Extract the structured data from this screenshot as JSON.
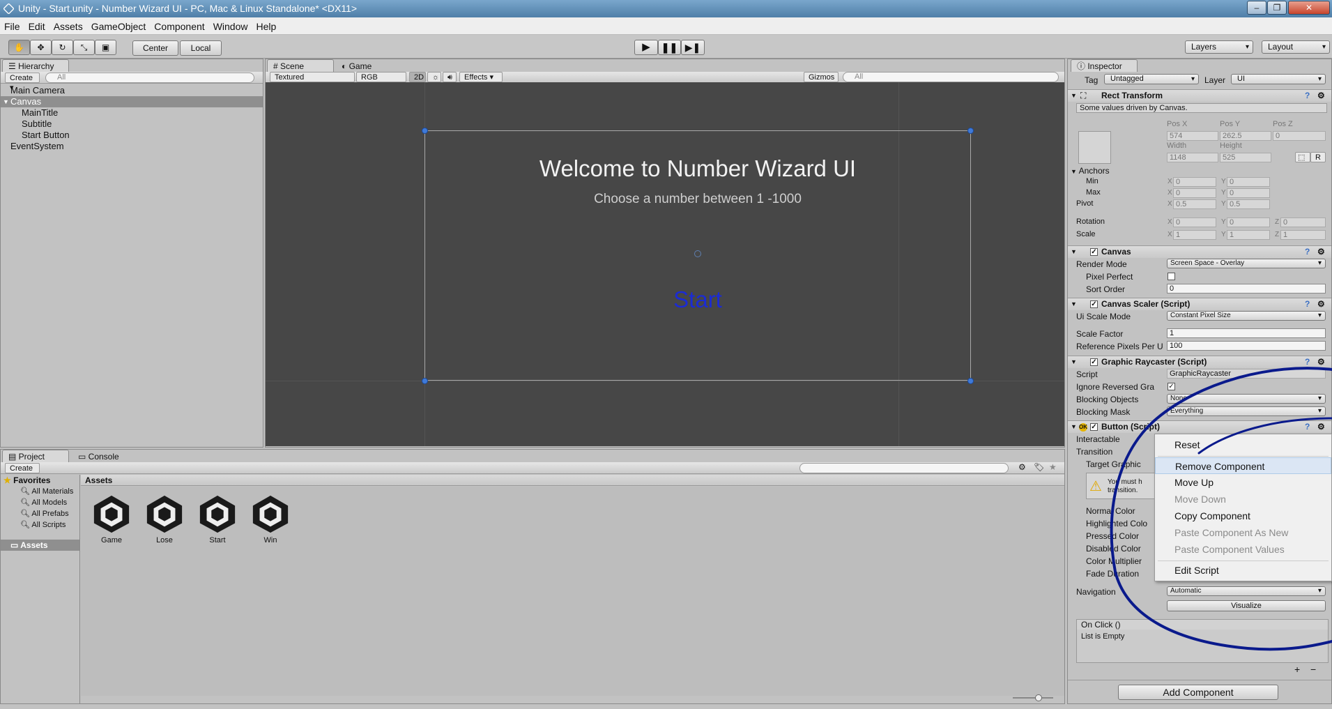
{
  "window": {
    "title": "Unity - Start.unity - Number Wizard UI - PC, Mac & Linux Standalone* <DX11>"
  },
  "menu": [
    "File",
    "Edit",
    "Assets",
    "GameObject",
    "Component",
    "Window",
    "Help"
  ],
  "toolbar": {
    "center": "Center",
    "local": "Local",
    "layers": "Layers",
    "layout": "Layout"
  },
  "hierarchy": {
    "tab": "Hierarchy",
    "create": "Create",
    "search": "All",
    "items": [
      "Main Camera",
      "Canvas",
      "MainTitle",
      "Subtitle",
      "Start Button",
      "EventSystem"
    ]
  },
  "scene": {
    "tab_scene": "Scene",
    "tab_game": "Game",
    "shading": "Textured",
    "rgb": "RGB",
    "mode2d": "2D",
    "effects": "Effects",
    "gizmos": "Gizmos",
    "search": "All",
    "title": "Welcome to Number Wizard UI",
    "subtitle": "Choose a number between 1 -1000",
    "start": "Start",
    "start_color": "#1b2bd4"
  },
  "project": {
    "tab_project": "Project",
    "tab_console": "Console",
    "create": "Create",
    "favorites": "Favorites",
    "fav_items": [
      "All Materials",
      "All Models",
      "All Prefabs",
      "All Scripts"
    ],
    "assets_folder": "Assets",
    "assets_header": "Assets",
    "assets": [
      "Game",
      "Lose",
      "Start",
      "Win"
    ]
  },
  "inspector": {
    "tab": "Inspector",
    "tag_label": "Tag",
    "tag": "Untagged",
    "layer_label": "Layer",
    "layer": "UI",
    "rect": {
      "title": "Rect Transform",
      "note": "Some values driven by Canvas.",
      "posx_l": "Pos X",
      "posy_l": "Pos Y",
      "posz_l": "Pos Z",
      "posx": "574",
      "posy": "262.5",
      "posz": "0",
      "width_l": "Width",
      "height_l": "Height",
      "width": "1148",
      "height": "525",
      "r": "R",
      "anchors": "Anchors",
      "min": "Min",
      "max": "Max",
      "minx": "0",
      "miny": "0",
      "maxx": "0",
      "maxy": "0",
      "pivot": "Pivot",
      "pivx": "0.5",
      "pivy": "0.5",
      "rotation": "Rotation",
      "rotx": "0",
      "roty": "0",
      "rotz": "0",
      "scale": "Scale",
      "sx": "1",
      "sy": "1",
      "sz": "1",
      "xl": "X",
      "yl": "Y",
      "zl": "Z"
    },
    "canvas": {
      "title": "Canvas",
      "render_mode_l": "Render Mode",
      "render_mode": "Screen Space - Overlay",
      "pixel_perfect": "Pixel Perfect",
      "sort_order_l": "Sort Order",
      "sort_order": "0"
    },
    "scaler": {
      "title": "Canvas Scaler (Script)",
      "mode_l": "Ui Scale Mode",
      "mode": "Constant Pixel Size",
      "factor_l": "Scale Factor",
      "factor": "1",
      "ref_l": "Reference Pixels Per U",
      "ref": "100"
    },
    "raycaster": {
      "title": "Graphic Raycaster (Script)",
      "script_l": "Script",
      "script": "GraphicRaycaster",
      "ignore_l": "Ignore Reversed Gra",
      "blocking_l": "Blocking Objects",
      "blocking": "None",
      "mask_l": "Blocking Mask",
      "mask": "Everything"
    },
    "button": {
      "title": "Button (Script)",
      "interactable": "Interactable",
      "transition": "Transition",
      "target": "Target Graphic",
      "warn": "You must h",
      "warn2": "transition.",
      "normal": "Normal Color",
      "highlighted": "Highlighted Colo",
      "pressed": "Pressed Color",
      "disabled": "Disabled Color",
      "multiplier": "Color Multiplier",
      "fade": "Fade Duration",
      "nav_l": "Navigation",
      "nav": "Automatic",
      "visualize": "Visualize",
      "onclick": "On Click ()",
      "empty": "List is Empty",
      "plus": "+",
      "minus": "−"
    },
    "add_component": "Add Component"
  },
  "context_menu": [
    "Reset",
    "Remove Component",
    "Move Up",
    "Move Down",
    "Copy Component",
    "Paste Component As New",
    "Paste Component Values",
    "Edit Script"
  ],
  "colors": {
    "annotation": "#0a1a8c"
  }
}
